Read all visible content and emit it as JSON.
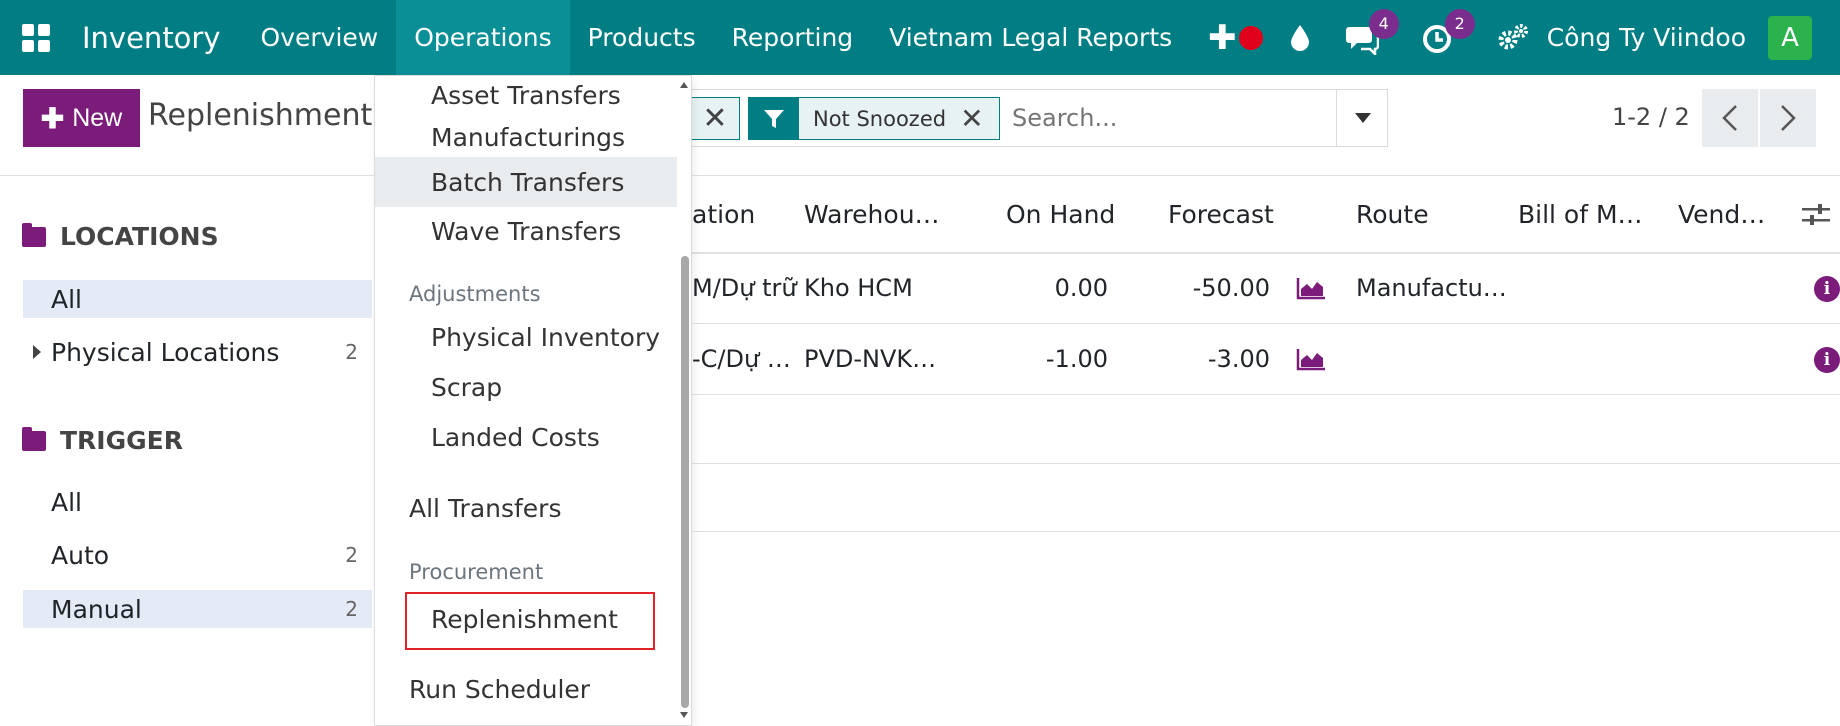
{
  "navbar": {
    "app_name": "Inventory",
    "menu": [
      "Overview",
      "Operations",
      "Products",
      "Reporting",
      "Vietnam Legal Reports"
    ],
    "active_menu": "Operations",
    "messages_badge": "4",
    "activities_badge": "2",
    "company": "Công Ty Viindoo",
    "avatar_letter": "A",
    "color": "#017e84"
  },
  "control_panel": {
    "new_label": "New",
    "title": "Replenishment",
    "facet_label": "Not Snoozed",
    "search_placeholder": "Search...",
    "pager": "1-2 / 2"
  },
  "sidebar": {
    "sections": [
      {
        "title": "LOCATIONS",
        "items": [
          {
            "label": "All",
            "count": "",
            "selected": true
          },
          {
            "label": "Physical Locations",
            "count": "2",
            "selected": false
          }
        ]
      },
      {
        "title": "TRIGGER",
        "items": [
          {
            "label": "All",
            "count": "",
            "selected": false
          },
          {
            "label": "Auto",
            "count": "2",
            "selected": false
          },
          {
            "label": "Manual",
            "count": "2",
            "selected": true
          }
        ]
      }
    ]
  },
  "table": {
    "columns": [
      "ation",
      "Warehou…",
      "On Hand",
      "Forecast",
      "Route",
      "Bill of M…",
      "Vend…"
    ],
    "rows": [
      {
        "location": "M/Dự trữ",
        "warehouse": "Kho HCM",
        "on_hand": "0.00",
        "forecast": "-50.00",
        "route": "Manufactu…"
      },
      {
        "location": "-C/Dự …",
        "warehouse": "PVD-NVK…",
        "on_hand": "-1.00",
        "forecast": "-3.00",
        "route": ""
      }
    ]
  },
  "dropdown": {
    "items_top": [
      "Asset Transfers",
      "Manufacturings",
      "Batch Transfers",
      "Wave Transfers"
    ],
    "hovered": "Batch Transfers",
    "adjustments_header": "Adjustments",
    "adjustments": [
      "Physical Inventory",
      "Scrap",
      "Landed Costs"
    ],
    "all_transfers": "All Transfers",
    "procurement_header": "Procurement",
    "replenishment": "Replenishment",
    "run_scheduler": "Run Scheduler",
    "highlight_color": "#e0232b"
  }
}
